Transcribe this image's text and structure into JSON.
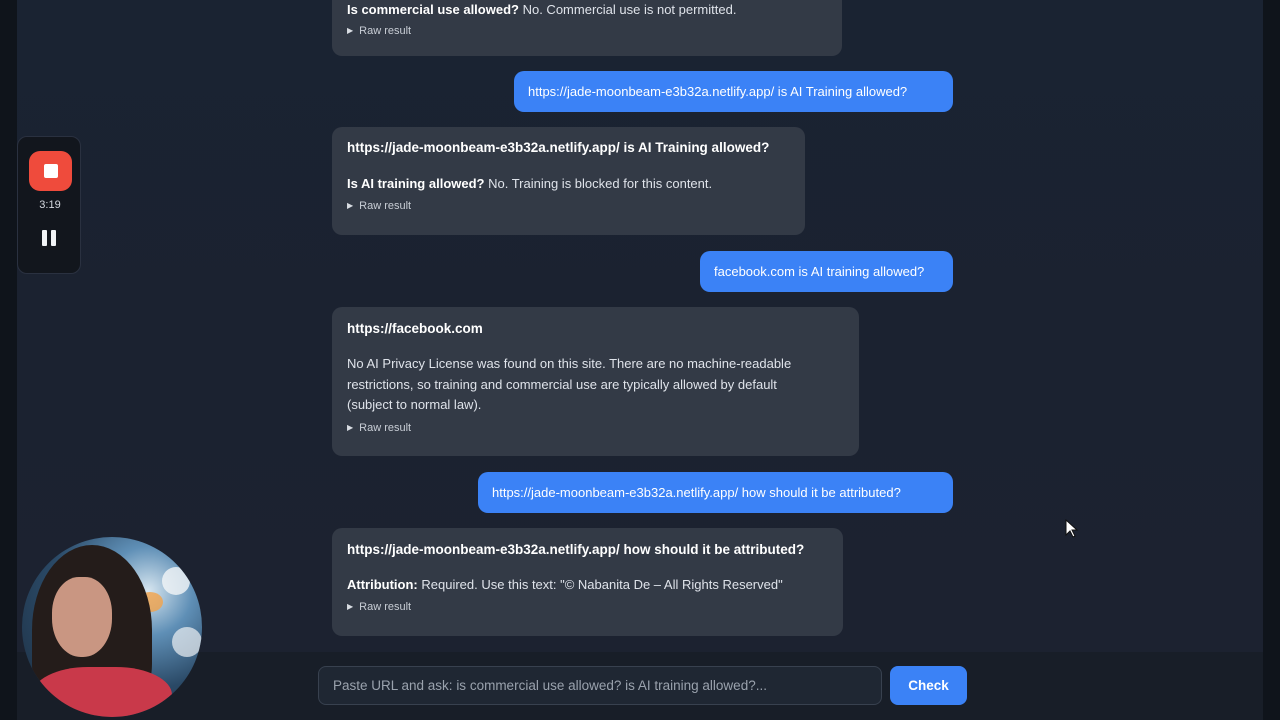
{
  "messages": {
    "m1": {
      "answer_label": "Is commercial use allowed?",
      "answer_text": "No. Commercial use is not permitted.",
      "raw": "Raw result"
    },
    "u1": {
      "text": "https://jade-moonbeam-e3b32a.netlify.app/ is AI Training allowed?"
    },
    "m2": {
      "title": "https://jade-moonbeam-e3b32a.netlify.app/ is AI Training allowed?",
      "answer_label": "Is AI training allowed?",
      "answer_text": "No. Training is blocked for this content.",
      "raw": "Raw result"
    },
    "u2": {
      "text": "facebook.com is AI training allowed?"
    },
    "m3": {
      "title": "https://facebook.com",
      "line1": "No AI Privacy License was found on this site. There are no machine-readable",
      "line2": "restrictions, so training and commercial use are typically allowed by default",
      "line3": "(subject to normal law).",
      "raw": "Raw result"
    },
    "u3": {
      "text": "https://jade-moonbeam-e3b32a.netlify.app/ how should it be attributed?"
    },
    "m4": {
      "title": "https://jade-moonbeam-e3b32a.netlify.app/ how should it be attributed?",
      "answer_label": "Attribution:",
      "answer_text": "Required. Use this text: \"© Nabanita De – All Rights Reserved\"",
      "raw": "Raw result"
    }
  },
  "composer": {
    "placeholder": "Paste URL and ask: is commercial use allowed? is AI training allowed?...",
    "check_label": "Check"
  },
  "recorder": {
    "time": "3:19"
  },
  "colors": {
    "accent": "#3b82f6",
    "record": "#ef4b3c",
    "bot_bubble": "#333a46"
  }
}
